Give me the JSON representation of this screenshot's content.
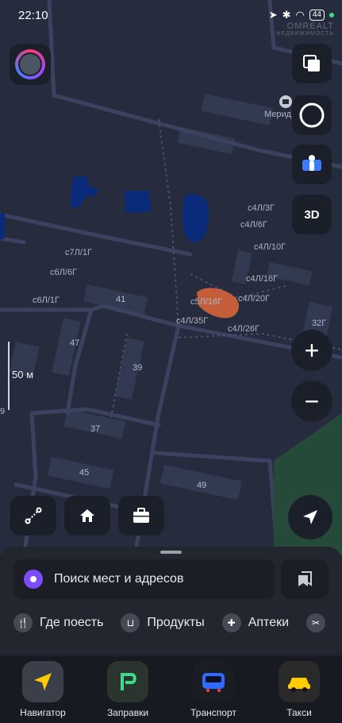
{
  "status_bar": {
    "time": "22:10",
    "battery": "44"
  },
  "watermark": {
    "brand": "OMREALT",
    "tagline": "НЕДВИЖИМОСТЬ"
  },
  "map": {
    "poi_label": "Мерид",
    "scale_label": "50 м",
    "plot_labels": [
      "с4Л/3Г",
      "с4Л/6Г",
      "с4Л/10Г",
      "с4Л/16Г",
      "с4Л/20Г",
      "с4Л/26Г",
      "с4Л/35Г",
      "с5Л/16Г",
      "с7Л/1Г",
      "с6Л/6Г",
      "с6Л/1Г",
      "32Г"
    ],
    "building_numbers": [
      "41",
      "47",
      "39",
      "37",
      "45",
      "49",
      "9"
    ]
  },
  "controls": {
    "three_d_label": "3D"
  },
  "search": {
    "placeholder": "Поиск мест и адресов"
  },
  "chips": [
    {
      "label": "Где поесть",
      "icon": "cutlery-icon"
    },
    {
      "label": "Продукты",
      "icon": "basket-icon"
    },
    {
      "label": "Аптеки",
      "icon": "plus-icon"
    }
  ],
  "dock": [
    {
      "label": "Навигатор",
      "icon": "navigator-icon",
      "color": "#3a3f4a"
    },
    {
      "label": "Заправки",
      "icon": "fuel-icon",
      "color": "#2a3530"
    },
    {
      "label": "Транспорт",
      "icon": "transport-icon",
      "color": "#1a1d24"
    },
    {
      "label": "Такси",
      "icon": "taxi-icon",
      "color": "#2a2a2a"
    }
  ],
  "colors": {
    "map_bg": "#262c3d",
    "water": "#0a2a7a",
    "highlight": "#e0673a",
    "accent": "#7c4dff"
  }
}
